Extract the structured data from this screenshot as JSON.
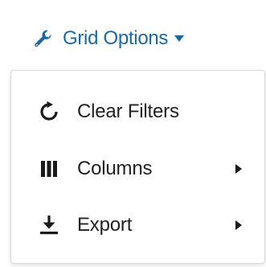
{
  "toggle": {
    "label": "Grid Options",
    "icon": "wrench-icon",
    "caret_icon": "caret-down-icon",
    "accent_color": "#1b6aa8"
  },
  "menu": {
    "items": [
      {
        "label": "Clear Filters",
        "icon": "refresh-icon",
        "has_submenu": false
      },
      {
        "label": "Columns",
        "icon": "columns-icon",
        "has_submenu": true
      },
      {
        "label": "Export",
        "icon": "download-icon",
        "has_submenu": true
      }
    ],
    "submenu_icon": "caret-right-icon",
    "text_color": "#222222"
  }
}
